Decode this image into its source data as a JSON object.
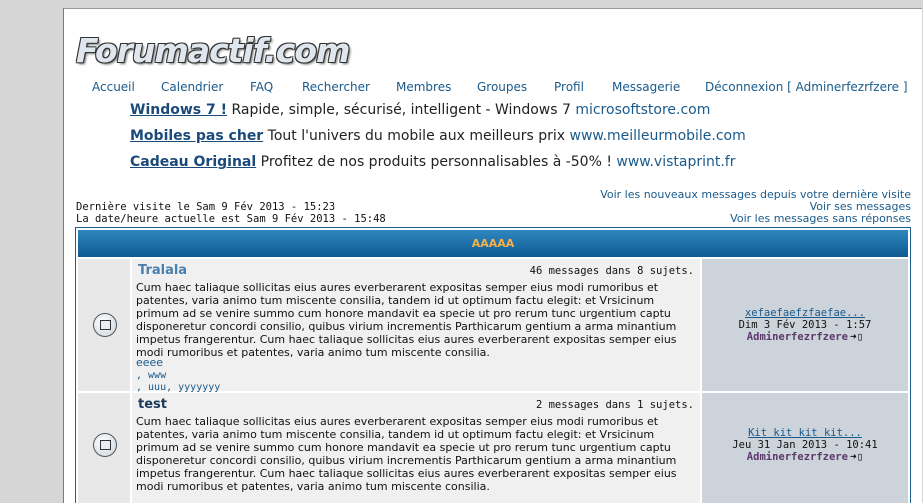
{
  "logo": "Forumactif.com",
  "nav": [
    "Accueil",
    "Calendrier",
    "FAQ",
    "Rechercher",
    "Membres",
    "Groupes",
    "Profil",
    "Messagerie",
    "Déconnexion [ Adminerfezrfzere ]"
  ],
  "ads": [
    {
      "title": "Windows 7 !",
      "desc": " Rapide, simple, sécurisé, intelligent - Windows 7 ",
      "url": "microsoftstore.com"
    },
    {
      "title": "Mobiles pas cher",
      "desc": " Tout l'univers du mobile aux meilleurs prix ",
      "url": "www.meilleurmobile.com"
    },
    {
      "title": "Cadeau Original",
      "desc": " Profitez de nos produits personnalisables à -50% ! ",
      "url": "www.vistaprint.fr"
    }
  ],
  "visit": {
    "last": "Dernière visite le Sam 9 Fév 2013 - 15:23",
    "current": "La date/heure actuelle est Sam 9 Fév 2013 - 15:48"
  },
  "links": [
    "Voir les nouveaux messages depuis votre dernière visite",
    "Voir ses messages",
    "Voir les messages sans réponses"
  ],
  "category": "AAAAA",
  "forums": [
    {
      "name": "Tralala",
      "count": "46 messages dans 8 sujets.",
      "desc": "Cum haec taliaque sollicitas eius aures everberarent expositas semper eius modi rumoribus et patentes, varia animo tum miscente consilia, tandem id ut optimum factu elegit: et Vrsicinum primum ad se venire summo cum honore mandavit ea specie ut pro rerum tunc urgentium captu disponeretur concordi consilio, quibus virium incrementis Parthicarum gentium a arma minantium impetus frangerentur. Cum haec taliaque sollicitas eius aures everberarent expositas semper eius modi rumoribus et patentes, varia animo tum miscente consilia.",
      "subforums_line1": "eeee",
      "subforums_line2": ", www",
      "subforums_line3": ", uuu, yyyyyyy",
      "last_title": "xefaefaefzfaefae...",
      "last_date": "Dim 3 Fév 2013 - 1:57",
      "last_author": "Adminerfezrfzere",
      "colors": {
        "name": "#4a7fae"
      }
    },
    {
      "name": "test",
      "count": "2 messages dans 1 sujets.",
      "desc": "Cum haec taliaque sollicitas eius aures everberarent expositas semper eius modi rumoribus et patentes, varia animo tum miscente consilia, tandem id ut optimum factu elegit: et Vrsicinum primum ad se venire summo cum honore mandavit ea specie ut pro rerum tunc urgentium captu disponeretur concordi consilio, quibus virium incrementis Parthicarum gentium a arma minantium impetus frangerentur. Cum haec taliaque sollicitas eius aures everberarent expositas semper eius modi rumoribus et patentes, varia animo tum miscente consilia.",
      "last_title": "Kit kit kit kit...",
      "last_date": "Jeu 31 Jan 2013 - 10:41",
      "last_author": "Adminerfezrfzere",
      "colors": {
        "name": "#1a3a5a"
      }
    }
  ],
  "icons": {
    "forum": "forum-folder-icon",
    "goto": "goto-last-post-icon"
  }
}
